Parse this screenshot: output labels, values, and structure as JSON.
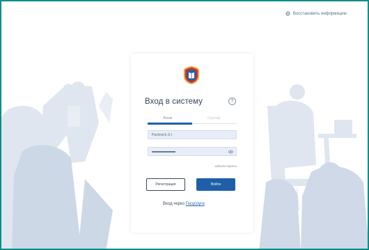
{
  "colors": {
    "frame_border": "#0a8f8a",
    "accent": "#1f5fa8",
    "card_bg": "#ffffff",
    "field_bg": "#e8eef7"
  },
  "topbar": {
    "link_label": "Восстановить информацию",
    "icon": "gear-icon"
  },
  "login": {
    "logo": "shield-book-logo",
    "title": "Вход в систему",
    "help_icon": "?",
    "tabs": [
      {
        "label": "Логин",
        "active": true
      },
      {
        "label": "Сертиф",
        "active": false
      }
    ],
    "username_value": "Pavlovich.S-l",
    "password_masked": true,
    "forgot_label": "забыли пароль",
    "register_label": "Регистрация",
    "submit_label": "Войти",
    "alt_prefix": "Вход через",
    "alt_link": "Госуслуги"
  }
}
